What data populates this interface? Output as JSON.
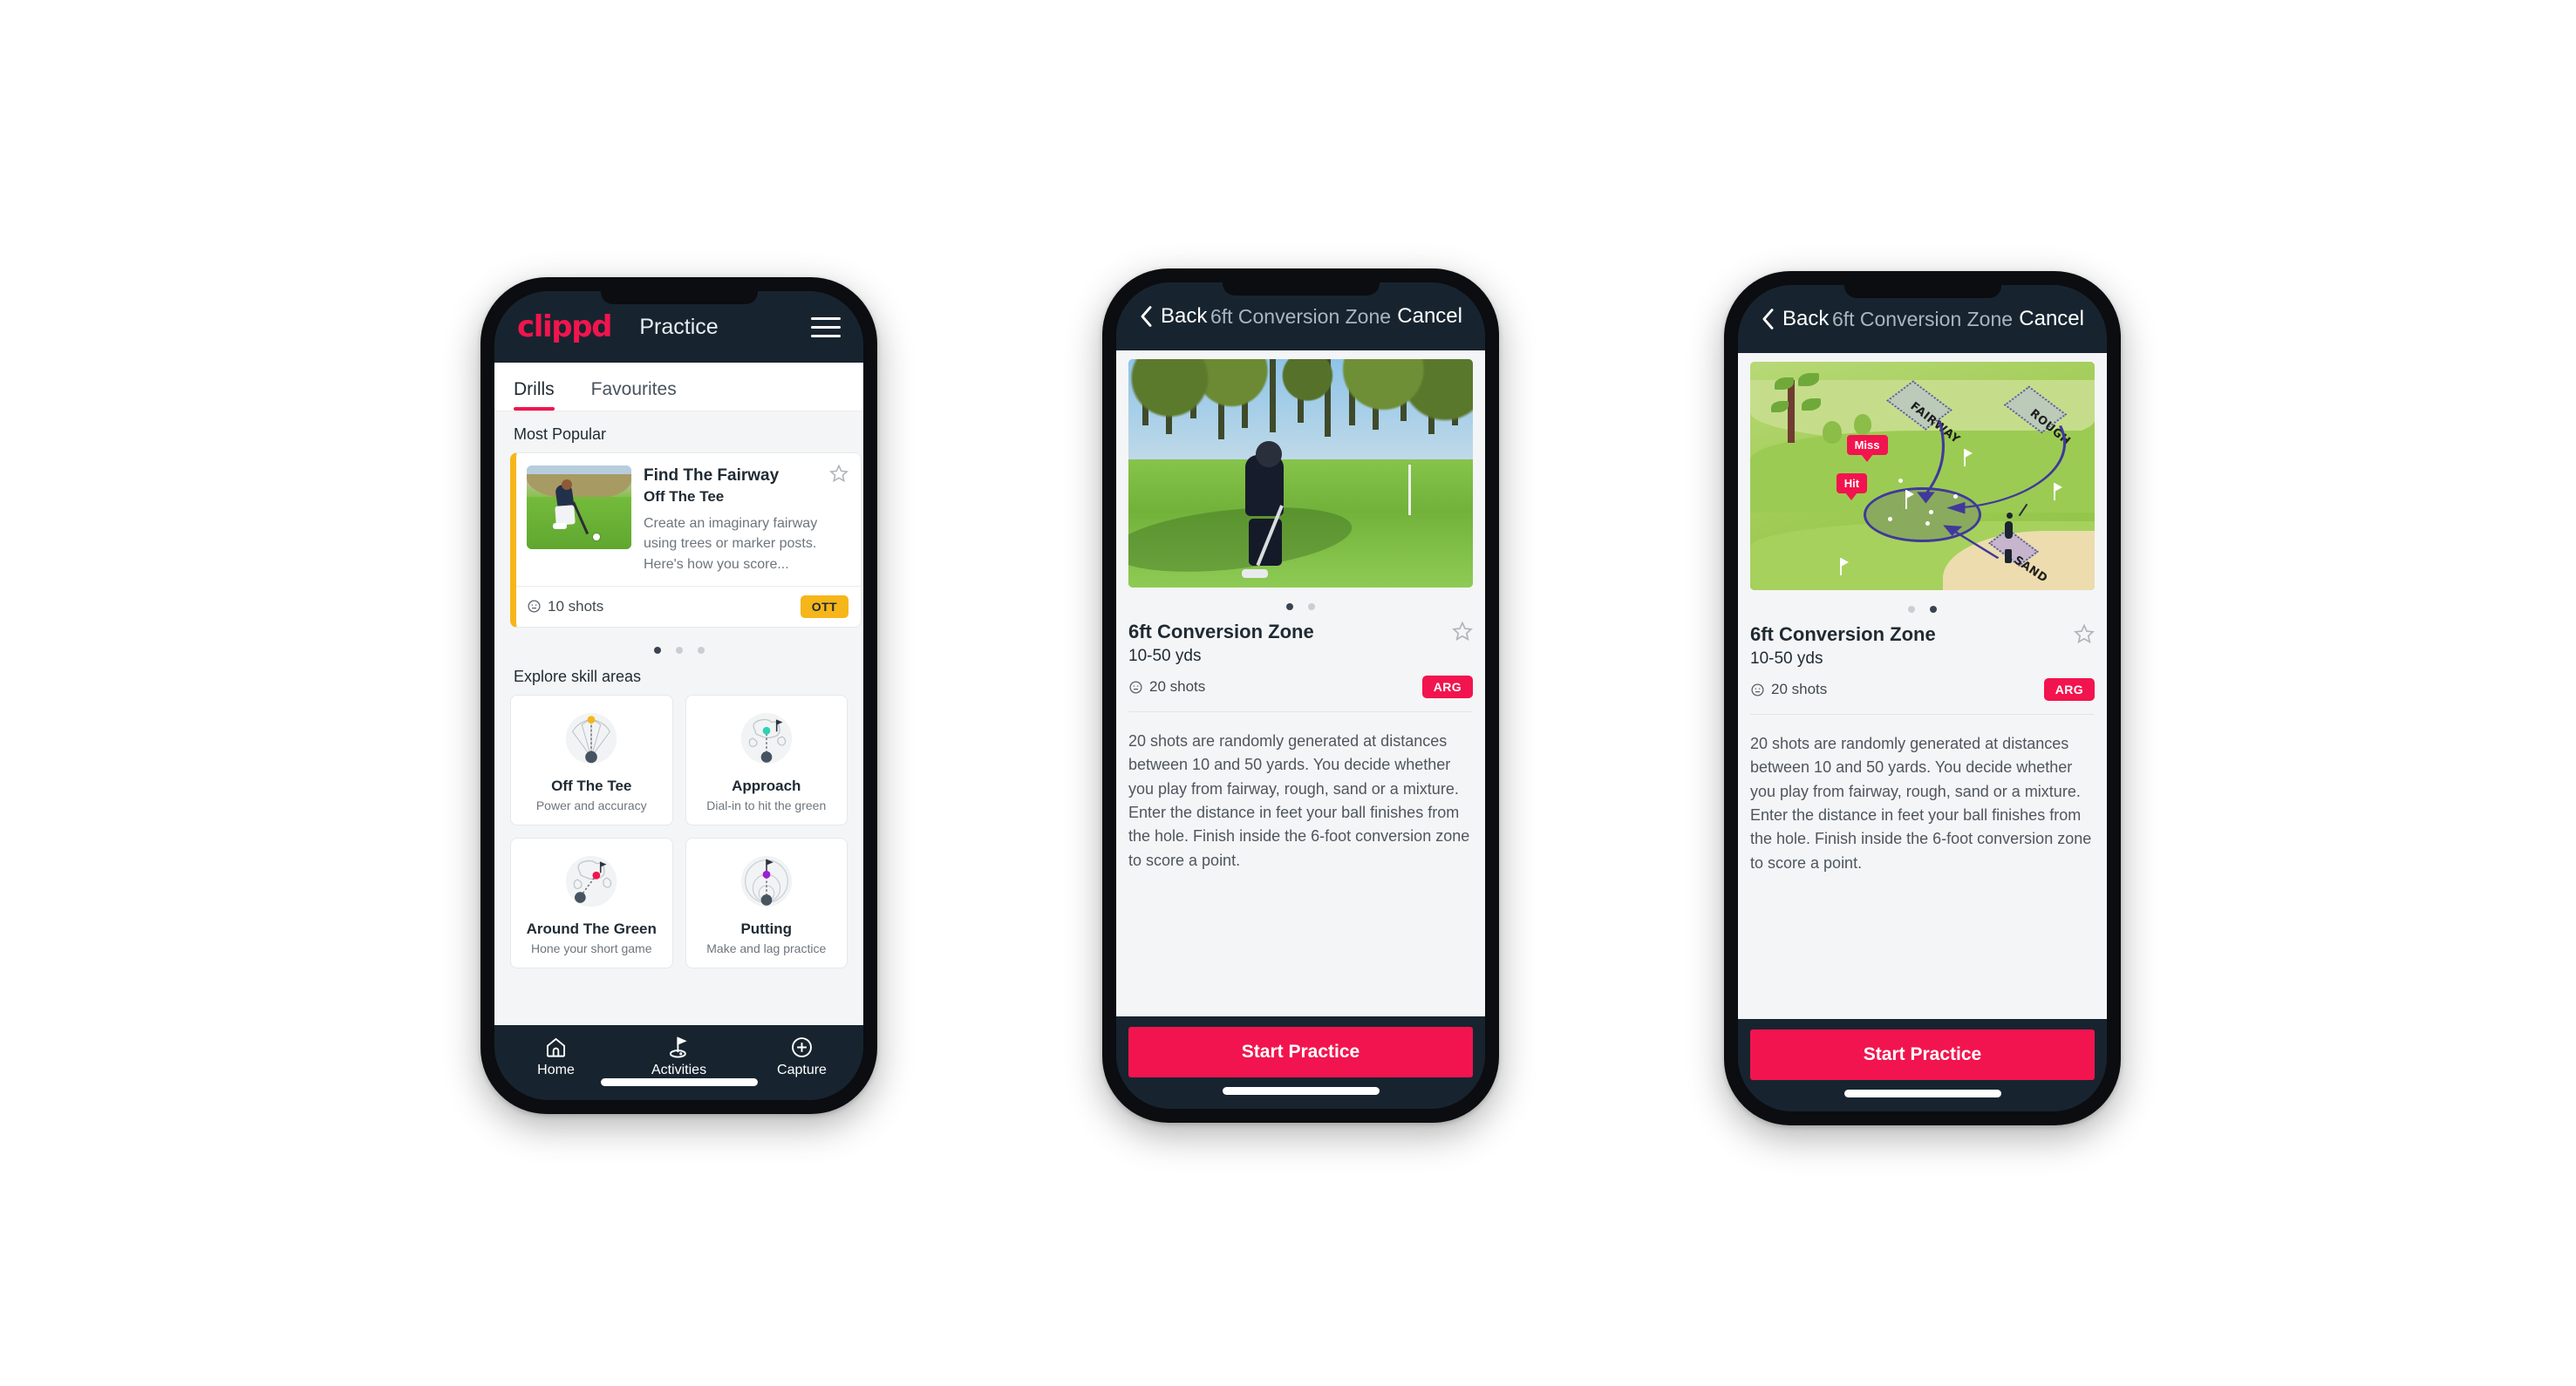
{
  "app": {
    "brand": "clippd",
    "accent_pink": "#f2144e",
    "dark_navy": "#17242f",
    "chip_yellow": "#f5b61a",
    "teal": "#2ad4b4"
  },
  "phone1": {
    "header": {
      "title": "Practice",
      "menu_icon": "hamburger-icon"
    },
    "tabs": [
      {
        "label": "Drills",
        "active": true
      },
      {
        "label": "Favourites",
        "active": false
      }
    ],
    "sections": {
      "most_popular_label": "Most Popular",
      "explore_label": "Explore skill areas"
    },
    "featured_drill": {
      "name": "Find The Fairway",
      "skill": "Off The Tee",
      "description": "Create an imaginary fairway using trees or marker posts. Here's how you score...",
      "shots": "10 shots",
      "chip": "OTT",
      "favourite_icon": "star-outline-icon",
      "accent_color": "#f5b61a"
    },
    "carousel_dots": {
      "count": 3,
      "active_index": 0
    },
    "skill_areas": [
      {
        "title": "Off The Tee",
        "subtitle": "Power and accuracy",
        "icon": "tee-fan-icon",
        "accent": "#f5b61a"
      },
      {
        "title": "Approach",
        "subtitle": "Dial-in to hit the green",
        "icon": "approach-green-icon",
        "accent": "#2ad4b4"
      },
      {
        "title": "Around The Green",
        "subtitle": "Hone your short game",
        "icon": "around-green-icon",
        "accent": "#f2144e"
      },
      {
        "title": "Putting",
        "subtitle": "Make and lag practice",
        "icon": "putting-rings-icon",
        "accent": "#9b1fd4"
      }
    ],
    "bottom_nav": [
      {
        "label": "Home",
        "icon": "home-icon",
        "active": false
      },
      {
        "label": "Activities",
        "icon": "golf-flag-icon",
        "active": true
      },
      {
        "label": "Capture",
        "icon": "plus-circle-icon",
        "active": false
      }
    ]
  },
  "phone2": {
    "header": {
      "back": "Back",
      "title": "6ft Conversion Zone",
      "cancel": "Cancel",
      "back_icon": "chevron-left-icon"
    },
    "hero": "golfer-chipping-photo",
    "carousel_dots": {
      "count": 2,
      "active_index": 0
    },
    "detail": {
      "name": "6ft Conversion Zone",
      "yards": "10-50 yds",
      "shots": "20 shots",
      "chip": "ARG",
      "favourite_icon": "star-outline-icon",
      "description": "20 shots are randomly generated at distances between 10 and 50 yards. You decide whether you play from fairway, rough, sand or a mixture. Enter the distance in feet your ball finishes from the hole. Finish inside the 6-foot conversion zone to score a point."
    },
    "cta": "Start Practice"
  },
  "phone3": {
    "header": {
      "back": "Back",
      "title": "6ft Conversion Zone",
      "cancel": "Cancel",
      "back_icon": "chevron-left-icon"
    },
    "hero": "course-diagram-illustration",
    "illustration_labels": {
      "fairway": "FAIRWAY",
      "rough": "ROUGH",
      "sand": "SAND",
      "miss": "Miss",
      "hit": "Hit"
    },
    "carousel_dots": {
      "count": 2,
      "active_index": 1
    },
    "detail": {
      "name": "6ft Conversion Zone",
      "yards": "10-50 yds",
      "shots": "20 shots",
      "chip": "ARG",
      "favourite_icon": "star-outline-icon",
      "description": "20 shots are randomly generated at distances between 10 and 50 yards. You decide whether you play from fairway, rough, sand or a mixture. Enter the distance in feet your ball finishes from the hole. Finish inside the 6-foot conversion zone to score a point."
    },
    "cta": "Start Practice"
  }
}
